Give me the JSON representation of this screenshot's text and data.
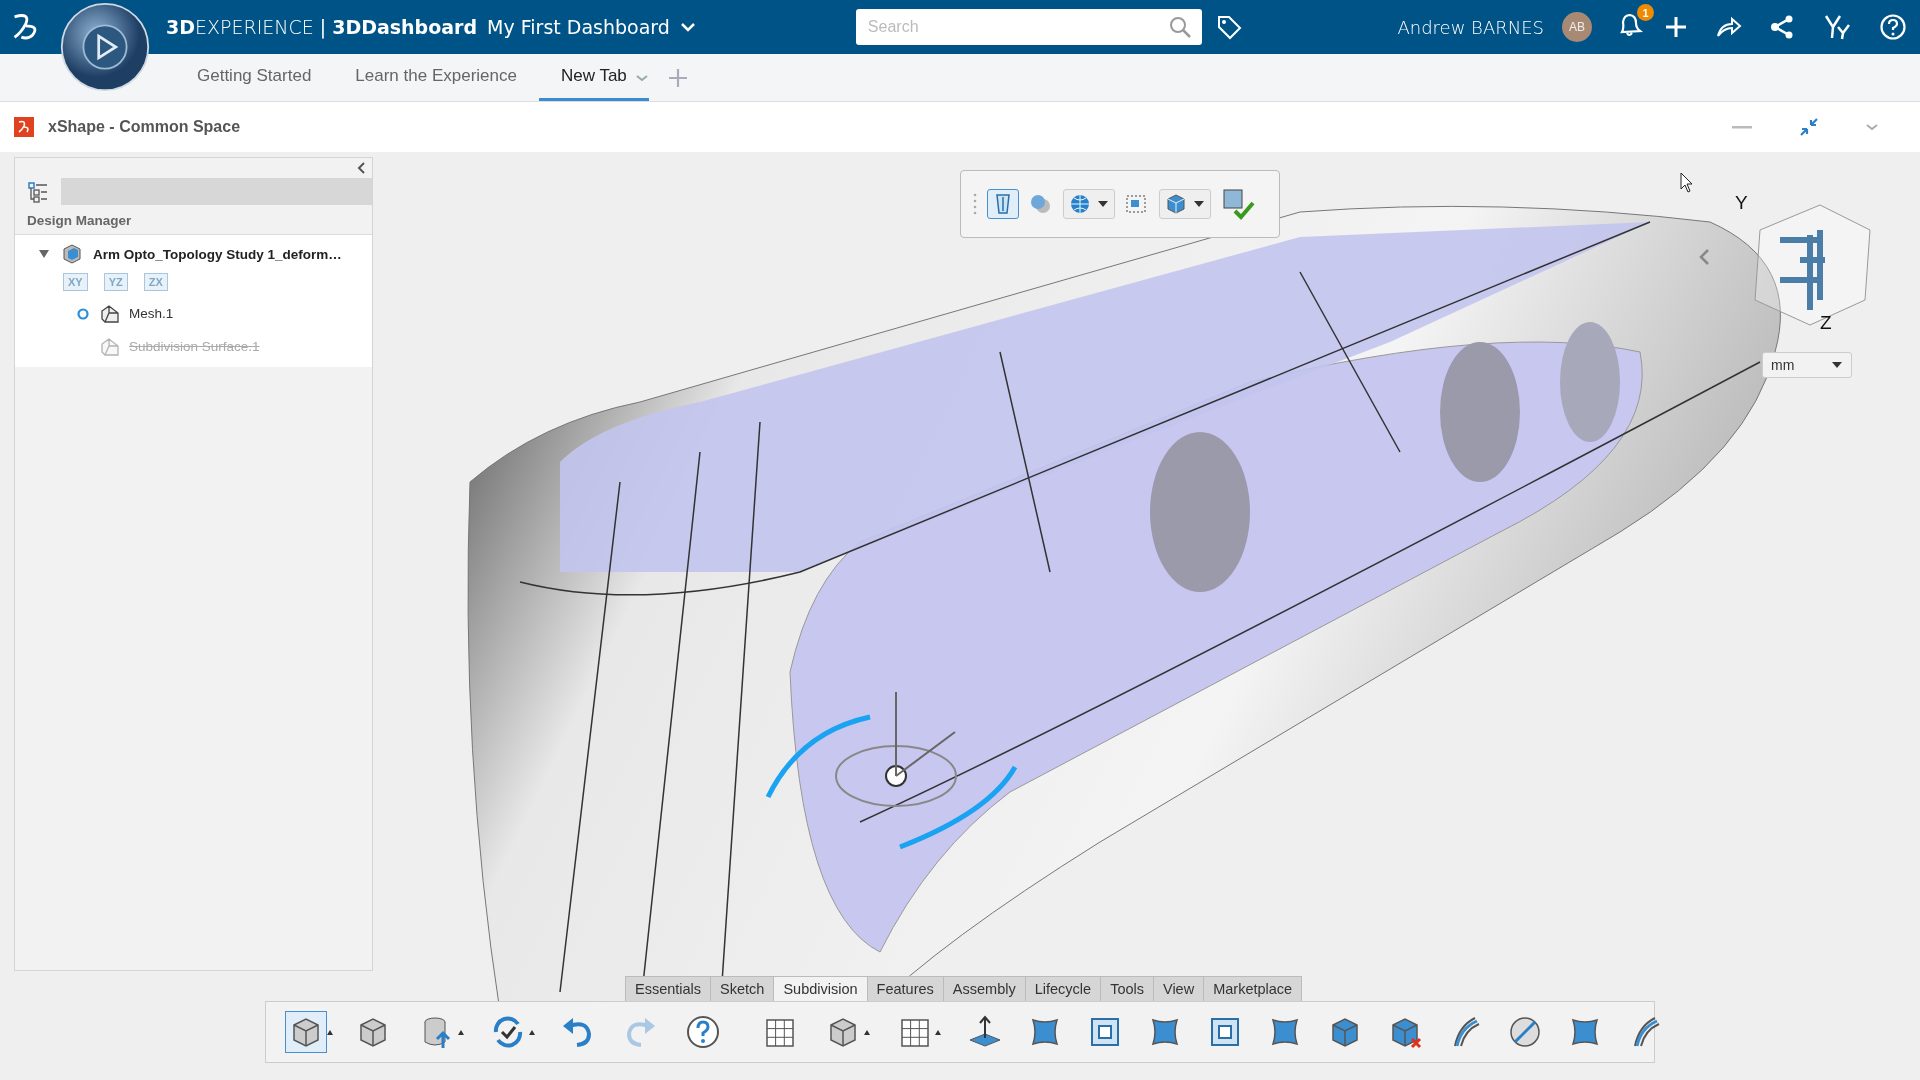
{
  "top_bar": {
    "brand_bold": "3D",
    "brand": "EXPERIENCE",
    "separator": "|",
    "app": "3DDashboard",
    "dashboard": "My First Dashboard",
    "search": {
      "placeholder": "Search"
    },
    "user": "Andrew BARNES",
    "avatar": "AB",
    "notification_count": "1"
  },
  "dashboard_tabs": [
    {
      "label": "Getting Started",
      "selected": false
    },
    {
      "label": "Learn the Experience",
      "selected": false
    },
    {
      "label": "New Tab",
      "selected": true
    }
  ],
  "app_title": "xShape - Common Space",
  "design_manager": {
    "title": "Design Manager",
    "planes": [
      "XY",
      "YZ",
      "ZX"
    ],
    "tree": [
      {
        "label": "Arm Opto_Topology Study 1_deform…",
        "expanded": true,
        "children": [
          {
            "label": "Mesh.1",
            "current": true,
            "deactivated": false
          },
          {
            "label": "Subdivision Surface.1",
            "current": false,
            "deactivated": true
          }
        ]
      }
    ]
  },
  "viewport": {
    "axes": [
      "Y",
      "Z"
    ],
    "unit": "mm"
  },
  "command_tabs": [
    {
      "label": "Essentials",
      "selected": false
    },
    {
      "label": "Sketch",
      "selected": false
    },
    {
      "label": "Subdivision",
      "selected": true
    },
    {
      "label": "Features",
      "selected": false
    },
    {
      "label": "Assembly",
      "selected": false
    },
    {
      "label": "Lifecycle",
      "selected": false
    },
    {
      "label": "Tools",
      "selected": false
    },
    {
      "label": "View",
      "selected": false
    },
    {
      "label": "Marketplace",
      "selected": false
    }
  ]
}
